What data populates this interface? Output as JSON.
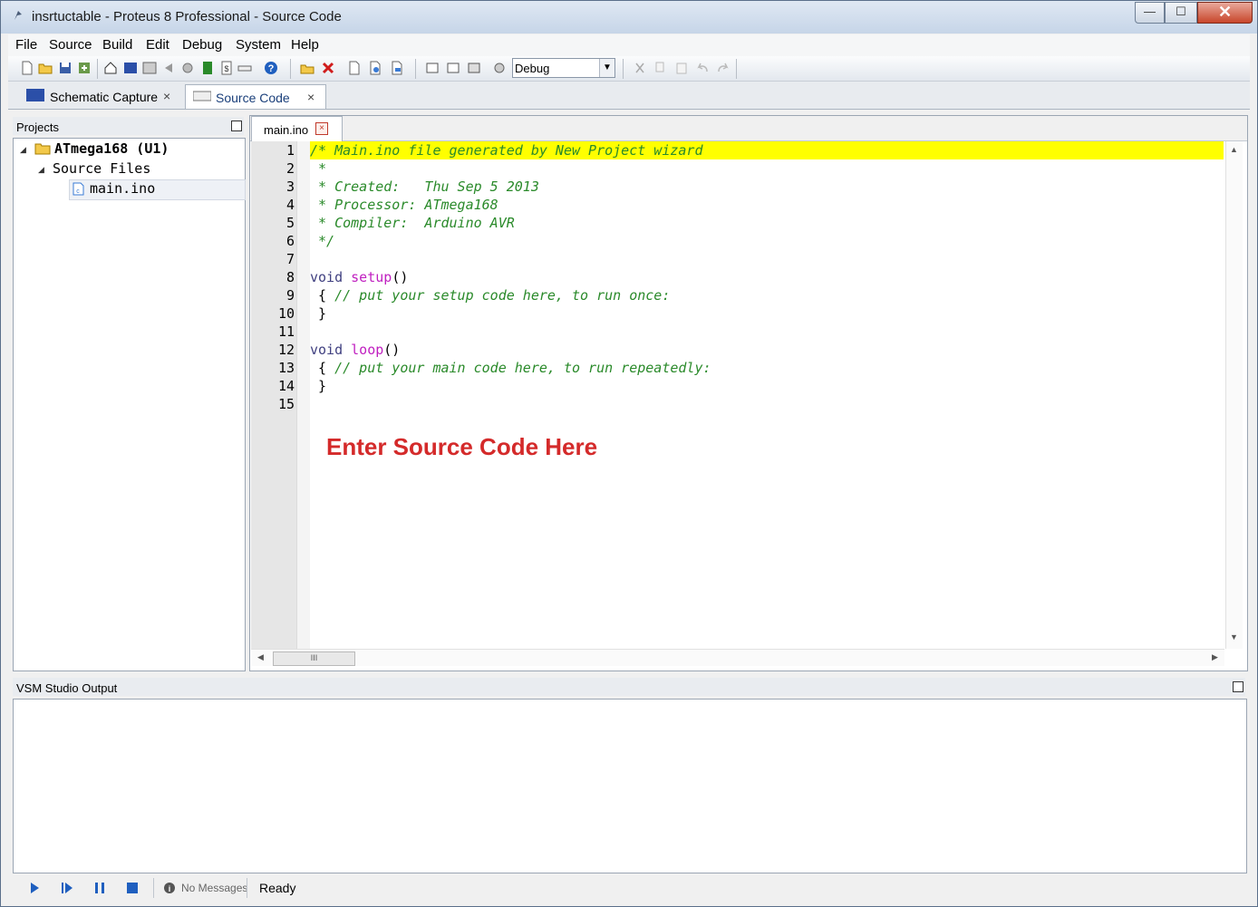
{
  "window": {
    "title": "insrtuctable - Proteus 8 Professional - Source Code",
    "controls": {
      "minimize": "—",
      "maximize": "☐",
      "close": "✕"
    }
  },
  "menu": [
    "File",
    "Source",
    "Build",
    "Edit",
    "Debug",
    "System",
    "Help"
  ],
  "toolbar": {
    "icons": [
      "new-file-icon",
      "open-folder-icon",
      "save-icon",
      "import-icon",
      "home-icon",
      "schematic-icon",
      "pcb-icon",
      "back-icon",
      "gear-icon",
      "bom-icon",
      "report-icon",
      "ruler-icon",
      "help-icon",
      "add-file-icon",
      "delete-icon",
      "blank-page-icon",
      "copy-page-icon",
      "paste-page-icon",
      "build-icon",
      "rebuild-icon",
      "clean-icon",
      "build-config-icon",
      "cut-icon",
      "copy-icon",
      "paste-icon",
      "undo-icon",
      "redo-icon"
    ],
    "config_value": "Debug"
  },
  "tabs": [
    {
      "label": "Schematic Capture",
      "close": "×"
    },
    {
      "label": "Source Code",
      "close": "×"
    }
  ],
  "projects_panel": {
    "title": "Projects",
    "tree": {
      "root": "ATmega168 (U1)",
      "folder": "Source Files",
      "file": "main.ino"
    }
  },
  "editor": {
    "tab": {
      "label": "main.ino",
      "close": "×"
    },
    "line_numbers": [
      "1",
      "2",
      "3",
      "4",
      "5",
      "6",
      "7",
      "8",
      "9",
      "10",
      "11",
      "12",
      "13",
      "14",
      "15"
    ],
    "lines": [
      [
        {
          "t": "/* Main.ino file generated by New Project wizard",
          "c": "cmt"
        }
      ],
      [
        {
          "t": " *",
          "c": "cmt"
        }
      ],
      [
        {
          "t": " * Created:   Thu Sep 5 2013",
          "c": "cmt"
        }
      ],
      [
        {
          "t": " * Processor: ATmega168",
          "c": "cmt"
        }
      ],
      [
        {
          "t": " * Compiler:  Arduino AVR",
          "c": "cmt"
        }
      ],
      [
        {
          "t": " */",
          "c": "cmt"
        }
      ],
      [],
      [
        {
          "t": "void ",
          "c": "kw"
        },
        {
          "t": "setup",
          "c": "fn"
        },
        {
          "t": "()",
          "c": "pl"
        }
      ],
      [
        {
          "t": " { ",
          "c": "pl"
        },
        {
          "t": "// put your setup code here, to run once:",
          "c": "cmt"
        }
      ],
      [
        {
          "t": " }",
          "c": "pl"
        }
      ],
      [],
      [
        {
          "t": "void ",
          "c": "kw"
        },
        {
          "t": "loop",
          "c": "fn"
        },
        {
          "t": "()",
          "c": "pl"
        }
      ],
      [
        {
          "t": " { ",
          "c": "pl"
        },
        {
          "t": "// put your main code here, to run repeatedly:",
          "c": "cmt"
        }
      ],
      [
        {
          "t": " }",
          "c": "pl"
        }
      ],
      []
    ],
    "annotation": "Enter Source Code Here",
    "scroll_thumb": "III"
  },
  "output_panel": {
    "title": "VSM Studio Output"
  },
  "statusbar": {
    "messages": "No Messages",
    "status": "Ready"
  }
}
